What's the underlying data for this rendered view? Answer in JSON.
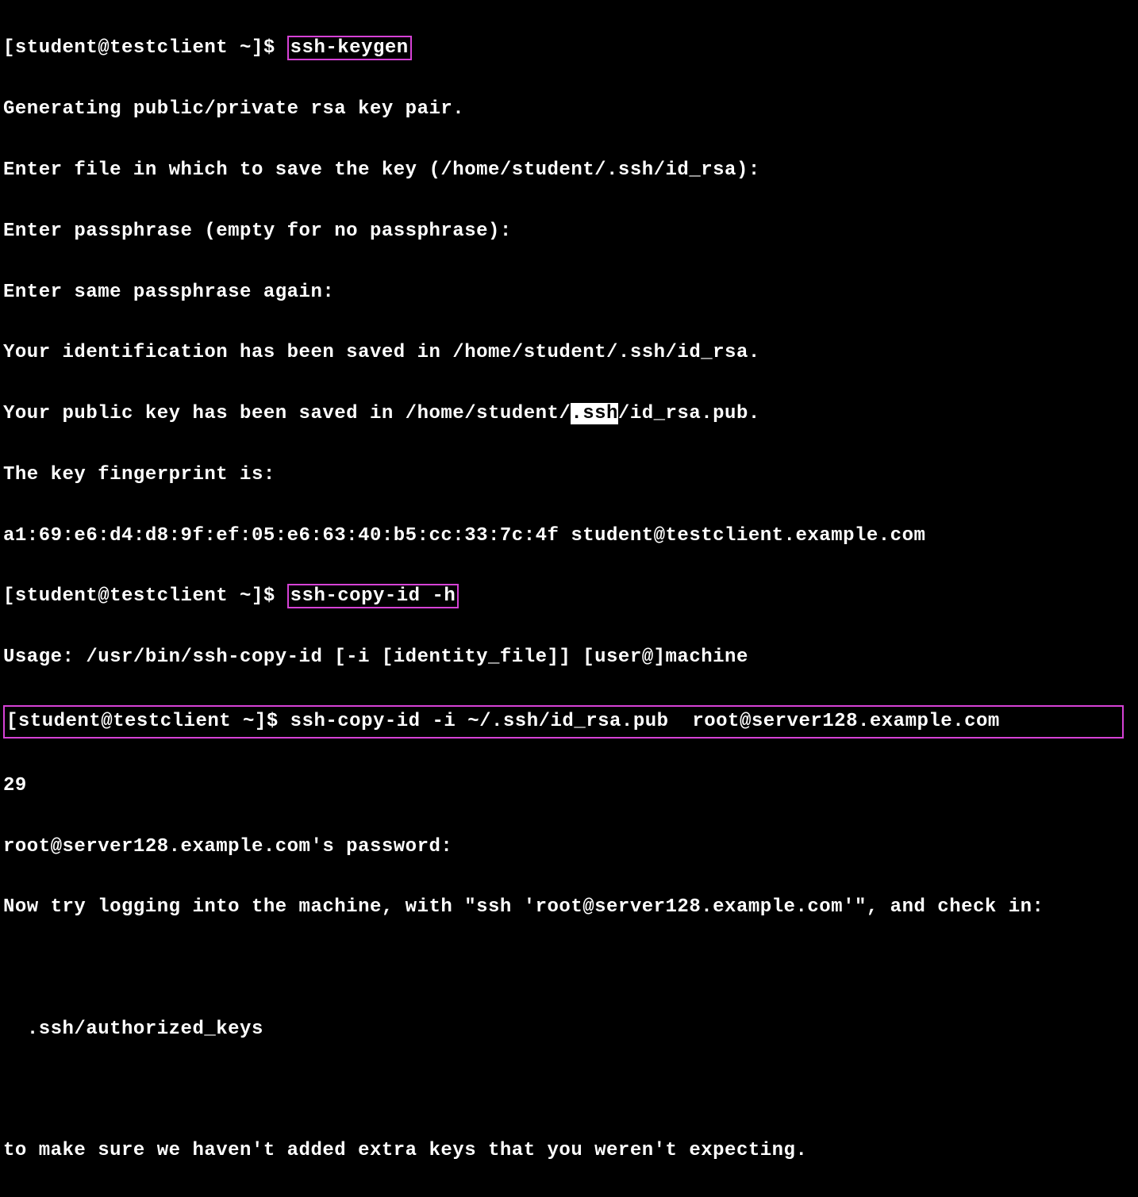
{
  "prompt1": "[student@testclient ~]$ ",
  "cmd1": "ssh-keygen",
  "out1": "Generating public/private rsa key pair.",
  "out2": "Enter file in which to save the key (/home/student/.ssh/id_rsa):",
  "out3": "Enter passphrase (empty for no passphrase):",
  "out4": "Enter same passphrase again:",
  "out5": "Your identification has been saved in /home/student/.ssh/id_rsa.",
  "out6a": "Your public key has been saved in /home/student/",
  "out6b": ".ssh",
  "out6c": "/id_rsa.pub.",
  "out7": "The key fingerprint is:",
  "out8": "a1:69:e6:d4:d8:9f:ef:05:e6:63:40:b5:cc:33:7c:4f student@testclient.example.com",
  "prompt2": "[student@testclient ~]$ ",
  "cmd2": "ssh-copy-id -h",
  "out9": "Usage: /usr/bin/ssh-copy-id [-i [identity_file]] [user@]machine",
  "prompt3": "[student@testclient ~]$ ",
  "cmd3": "ssh-copy-id -i ~/.ssh/id_rsa.pub  root@server128.example.com",
  "out10": "29",
  "out11": "root@server128.example.com's password:",
  "out12": "Now try logging into the machine, with \"ssh 'root@server128.example.com'\", and check in:",
  "out13": "  .ssh/authorized_keys",
  "out14": "to make sure we haven't added extra keys that you weren't expecting."
}
